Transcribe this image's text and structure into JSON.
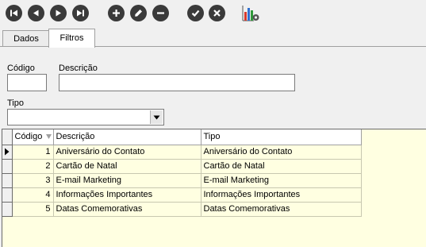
{
  "colors": {
    "toolbar_icon": "#3a3a3a",
    "grid_background": "#ffffe1",
    "chart_bars": [
      "#d83a2e",
      "#2f6fd0",
      "#2f9a3a",
      "#e0a020"
    ]
  },
  "toolbar": {
    "icons": [
      "first-icon",
      "previous-icon",
      "next-icon",
      "last-icon",
      "add-icon",
      "edit-icon",
      "remove-icon",
      "confirm-icon",
      "cancel-icon",
      "report-chart-icon"
    ]
  },
  "tabs": [
    {
      "label": "Dados",
      "active": false
    },
    {
      "label": "Filtros",
      "active": true
    }
  ],
  "filters": {
    "codigo_label": "Código",
    "codigo_value": "",
    "descricao_label": "Descrição",
    "descricao_value": "",
    "tipo_label": "Tipo",
    "tipo_value": ""
  },
  "grid": {
    "columns": [
      "Código",
      "Descrição",
      "Tipo"
    ],
    "rows": [
      {
        "codigo": "1",
        "descricao": "Aniversário do Contato",
        "tipo": "Aniversário do Contato"
      },
      {
        "codigo": "2",
        "descricao": "Cartão de Natal",
        "tipo": "Cartão de Natal"
      },
      {
        "codigo": "3",
        "descricao": "E-mail Marketing",
        "tipo": "E-mail Marketing"
      },
      {
        "codigo": "4",
        "descricao": "Informações Importantes",
        "tipo": "Informações Importantes"
      },
      {
        "codigo": "5",
        "descricao": "Datas Comemorativas",
        "tipo": "Datas Comemorativas"
      }
    ],
    "current_row": 0
  }
}
